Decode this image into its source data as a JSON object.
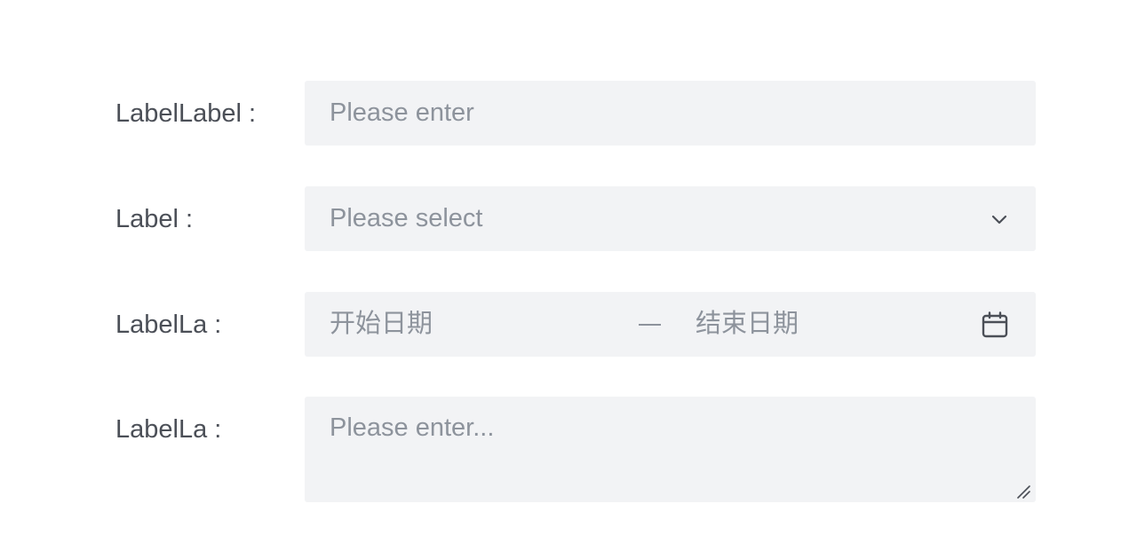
{
  "form": {
    "rows": [
      {
        "label": "LabelLabel :",
        "placeholder": "Please enter",
        "type": "text-input"
      },
      {
        "label": "Label :",
        "placeholder": "Please select",
        "type": "select",
        "icon": "chevron-down-icon"
      },
      {
        "label": "LabelLa :",
        "start_placeholder": "开始日期",
        "separator": "–",
        "end_placeholder": "结束日期",
        "type": "date-range",
        "icon": "calendar-icon"
      },
      {
        "label": "LabelLa :",
        "placeholder": "Please enter...",
        "type": "textarea",
        "icon": "resize-handle-icon"
      }
    ]
  },
  "colors": {
    "label_text": "#4b4f57",
    "placeholder_text": "#8d939c",
    "field_background": "#f2f3f5",
    "icon": "#4b4f57"
  }
}
